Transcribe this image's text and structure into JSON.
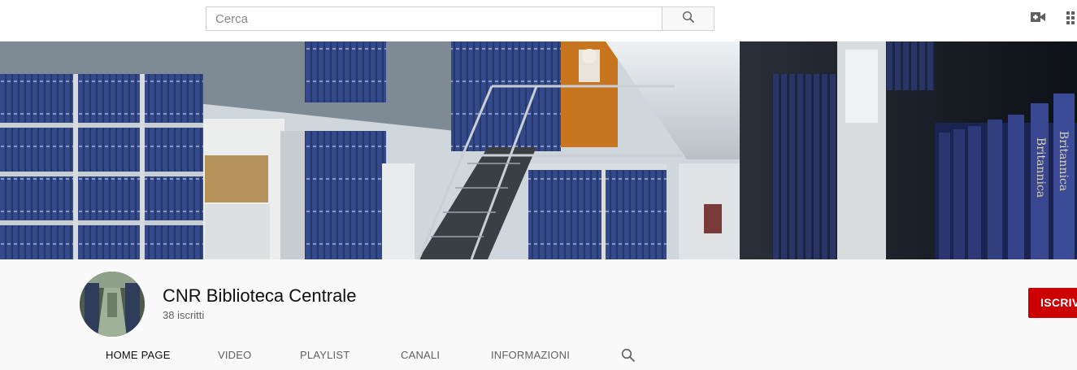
{
  "masthead": {
    "search_placeholder": "Cerca",
    "icons": [
      "search-icon",
      "create-video-icon",
      "apps-grid-icon"
    ]
  },
  "banner": {
    "description_icon": "library-banner-image",
    "book_spine_text": "Britannica"
  },
  "channel": {
    "name": "CNR Biblioteca Centrale",
    "subscribers": "38 iscritti",
    "subscribe_label": "ISCRIVITI"
  },
  "tabs": [
    {
      "label": "HOME PAGE",
      "active": true
    },
    {
      "label": "VIDEO",
      "active": false
    },
    {
      "label": "PLAYLIST",
      "active": false
    },
    {
      "label": "CANALI",
      "active": false
    },
    {
      "label": "INFORMAZIONI",
      "active": false
    }
  ],
  "colors": {
    "subscribe": "#cc0000",
    "shelf_books": "#2b3f7a"
  }
}
